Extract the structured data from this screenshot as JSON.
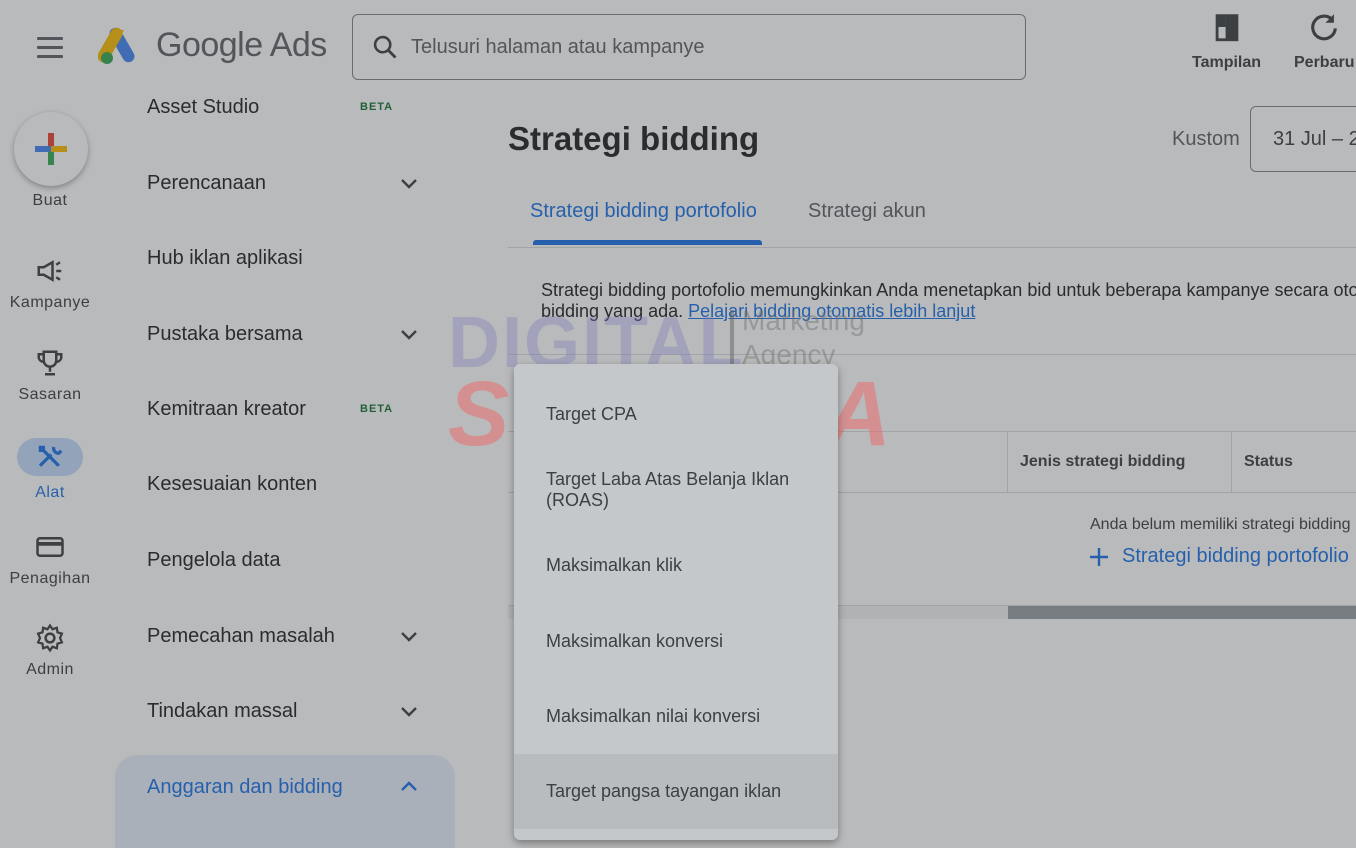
{
  "app": {
    "logo_text": "Google Ads"
  },
  "search": {
    "placeholder": "Telusuri halaman atau kampanye"
  },
  "top_actions": [
    {
      "label": "Tampilan",
      "icon": "view-icon"
    },
    {
      "label": "Perbaru",
      "icon": "refresh-icon"
    }
  ],
  "rail": {
    "create_label": "Buat",
    "items": [
      {
        "label": "Kampanye",
        "icon": "megaphone-icon"
      },
      {
        "label": "Sasaran",
        "icon": "trophy-icon"
      },
      {
        "label": "Alat",
        "icon": "tools-icon",
        "active": true
      },
      {
        "label": "Penagihan",
        "icon": "credit-card-icon"
      },
      {
        "label": "Admin",
        "icon": "gear-icon"
      }
    ]
  },
  "nav": {
    "items": [
      {
        "label": "Asset Studio",
        "badge": "BETA"
      },
      {
        "label": "Perencanaan",
        "expandable": true
      },
      {
        "label": "Hub iklan aplikasi"
      },
      {
        "label": "Pustaka bersama",
        "expandable": true
      },
      {
        "label": "Kemitraan kreator",
        "badge": "BETA"
      },
      {
        "label": "Kesesuaian konten"
      },
      {
        "label": "Pengelola data"
      },
      {
        "label": "Pemecahan masalah",
        "expandable": true
      },
      {
        "label": "Tindakan massal",
        "expandable": true
      },
      {
        "label": "Anggaran dan bidding",
        "expandable": true,
        "active": true
      }
    ]
  },
  "main": {
    "title": "Strategi bidding",
    "date_label": "Kustom",
    "date_value": "31 Jul – 2",
    "tabs": [
      {
        "label": "Strategi bidding portofolio",
        "active": true
      },
      {
        "label": "Strategi akun"
      }
    ],
    "description_line1": "Strategi bidding portofolio memungkinkan Anda menetapkan bid untuk beberapa kampanye secara otoma",
    "description_line2": "bidding yang ada.",
    "description_link": "Pelajari bidding otomatis lebih lanjut",
    "table": {
      "columns": [
        "Jenis strategi bidding",
        "Status"
      ],
      "empty_message": "Anda belum memiliki strategi bidding",
      "add_label": "Strategi bidding portofolio"
    }
  },
  "dropdown": {
    "items": [
      "Target CPA",
      "Target Laba Atas Belanja Iklan (ROAS)",
      "Maksimalkan klik",
      "Maksimalkan konversi",
      "Maksimalkan nilai konversi",
      "Target pangsa tayangan iklan"
    ]
  },
  "watermark": {
    "line1": "DIGITAL",
    "line2": "Marketing",
    "line3": "Agency",
    "line4": "SUKARIA"
  },
  "colors": {
    "accent": "#1a73e8",
    "overlay": "#3c4043"
  }
}
